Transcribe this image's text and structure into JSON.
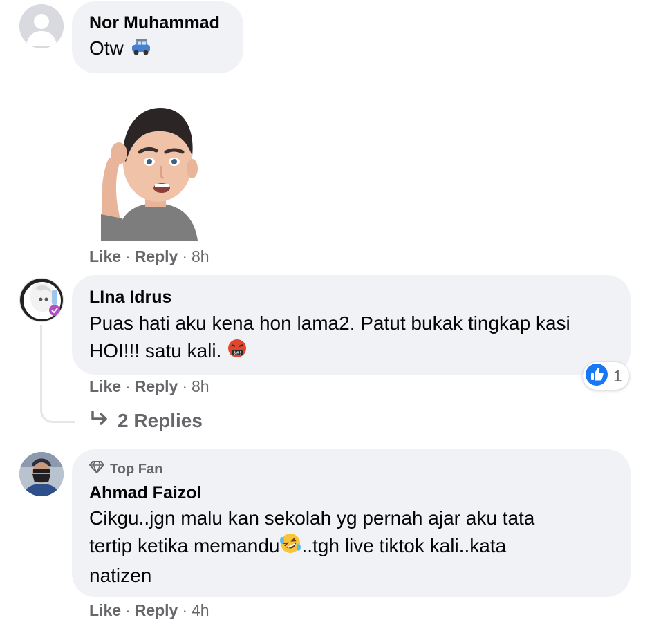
{
  "comments": [
    {
      "author": "Nor Muhammad",
      "text": "Otw",
      "emoji": "car-emoji",
      "sticker": "confused-avatar-sticker",
      "actions": {
        "like": "Like",
        "dot": "·",
        "reply": "Reply",
        "time": "8h"
      },
      "avatar": "default-avatar"
    },
    {
      "author": "LIna Idrus",
      "text_line1": "Puas hati aku kena hon lama2. Patut bukak tingkap kasi",
      "text_line2": "HOI!!! satu kali.",
      "emoji": "angry-swearing-emoji",
      "reaction": {
        "icon": "like-reaction-icon",
        "count": "1"
      },
      "actions": {
        "like": "Like",
        "dot": "·",
        "reply": "Reply",
        "time": "8h"
      },
      "replies": "2 Replies"
    },
    {
      "badge": "Top Fan",
      "author": "Ahmad Faizol",
      "text_line1": "Cikgu..jgn malu kan sekolah yg pernah ajar aku tata",
      "text_line2a": "tertip ketika memandu",
      "text_line2b": "..tgh live tiktok kali..kata",
      "text_line3": "natizen",
      "emoji": "rolling-laughing-emoji",
      "actions": {
        "like": "Like",
        "dot": "·",
        "reply": "Reply",
        "time": "4h"
      }
    }
  ],
  "colors": {
    "bubble": "#f0f2f5",
    "muted": "#65676b",
    "like_blue": "#1877f2"
  }
}
